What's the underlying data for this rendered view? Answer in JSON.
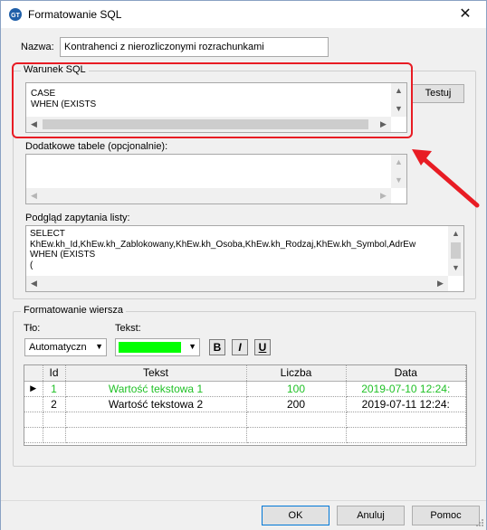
{
  "window": {
    "title": "Formatowanie SQL",
    "close_glyph": "✕"
  },
  "name_field": {
    "label": "Nazwa:",
    "value": "Kontrahenci z nierozliczonymi rozrachunkami"
  },
  "sql_condition": {
    "group_label": "Warunek SQL",
    "text": "CASE\nWHEN (EXISTS",
    "test_button": "Testuj"
  },
  "extra_tables": {
    "label": "Dodatkowe tabele (opcjonalnie):",
    "text": ""
  },
  "preview": {
    "label": "Podgląd zapytania listy:",
    "text": "SELECT\nKhEw.kh_Id,KhEw.kh_Zablokowany,KhEw.kh_Osoba,KhEw.kh_Rodzaj,KhEw.kh_Symbol,AdrEw\nWHEN (EXISTS\n("
  },
  "row_format": {
    "group_label": "Formatowanie wiersza",
    "bg_label": "Tło:",
    "bg_value": "Automatyczn",
    "text_label": "Tekst:",
    "text_color": "#00ff00",
    "bold_glyph": "B",
    "italic_glyph": "I",
    "underline_glyph": "U"
  },
  "grid": {
    "columns": [
      "Id",
      "Tekst",
      "Liczba",
      "Data"
    ],
    "rows": [
      {
        "marker": "▶",
        "id": "1",
        "text": "Wartość tekstowa 1",
        "number": "100",
        "date": "2019-07-10 12:24:"
      },
      {
        "marker": "",
        "id": "2",
        "text": "Wartość tekstowa 2",
        "number": "200",
        "date": "2019-07-11 12:24:"
      }
    ]
  },
  "buttons": {
    "ok": "OK",
    "cancel": "Anuluj",
    "help": "Pomoc"
  },
  "colors": {
    "highlight": "#e81c24",
    "arrow": "#e81c24",
    "green_text": "#21c127"
  }
}
